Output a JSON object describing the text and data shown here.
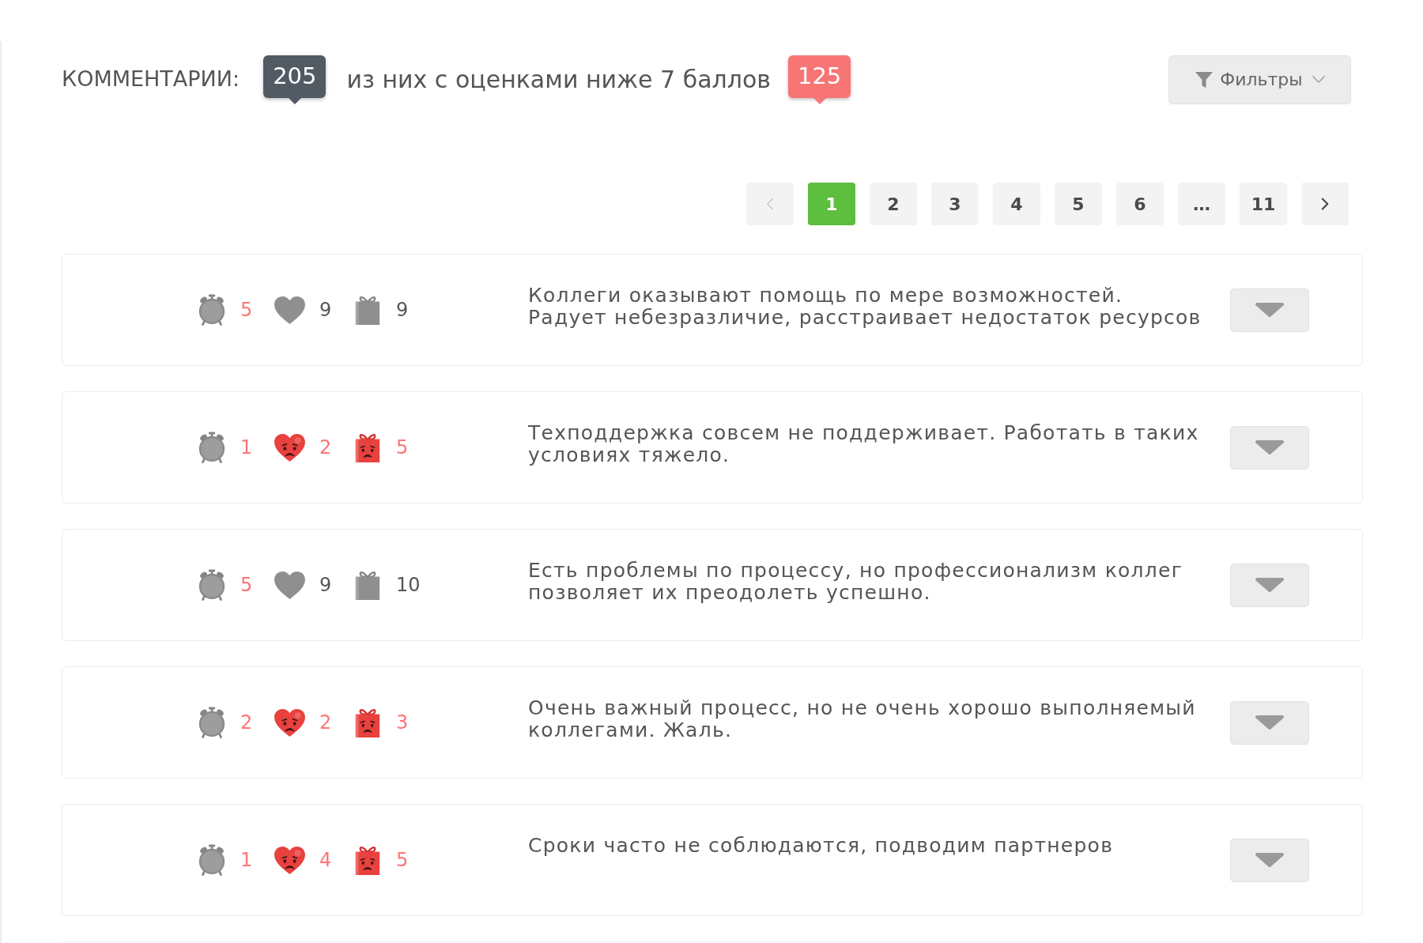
{
  "header": {
    "title": "КОММЕНТАРИИ:",
    "total": "205",
    "caption": "из них с оценками ниже 7 баллов",
    "low_count": "125",
    "filter_button": "Фильтры"
  },
  "pagination": [
    {
      "kind": "prev",
      "disabled": true
    },
    {
      "kind": "page",
      "label": "1",
      "selected": true
    },
    {
      "kind": "page",
      "label": "2",
      "selected": false
    },
    {
      "kind": "page",
      "label": "3",
      "selected": false
    },
    {
      "kind": "page",
      "label": "4",
      "selected": false
    },
    {
      "kind": "page",
      "label": "5",
      "selected": false
    },
    {
      "kind": "page",
      "label": "6",
      "selected": false
    },
    {
      "kind": "gap",
      "label": "…"
    },
    {
      "kind": "page",
      "label": "11",
      "selected": false
    },
    {
      "kind": "next",
      "disabled": false
    }
  ],
  "comments": [
    {
      "metrics": [
        {
          "kind": "clock",
          "value": "5",
          "low": true
        },
        {
          "kind": "heart",
          "value": "9",
          "low": false
        },
        {
          "kind": "gift",
          "value": "9",
          "low": false
        }
      ],
      "text": "Коллеги оказывают помощь по мере возможностей.\nРадует небезразличие, расстраивает недостаток ресурсов"
    },
    {
      "metrics": [
        {
          "kind": "clock",
          "value": "1",
          "low": true
        },
        {
          "kind": "heart",
          "value": "2",
          "low": true
        },
        {
          "kind": "gift",
          "value": "5",
          "low": true
        }
      ],
      "text": "Техподдержка совсем не поддерживает. Работать в таких условиях тяжело."
    },
    {
      "metrics": [
        {
          "kind": "clock",
          "value": "5",
          "low": true
        },
        {
          "kind": "heart",
          "value": "9",
          "low": false
        },
        {
          "kind": "gift",
          "value": "10",
          "low": false
        }
      ],
      "text": "Есть проблемы по процессу, но профессионализм коллег позволяет их преодолеть успешно."
    },
    {
      "metrics": [
        {
          "kind": "clock",
          "value": "2",
          "low": true
        },
        {
          "kind": "heart",
          "value": "2",
          "low": true
        },
        {
          "kind": "gift",
          "value": "3",
          "low": true
        }
      ],
      "text": "Очень важный процесс, но не очень хорошо выполняемый коллегами. Жаль."
    },
    {
      "metrics": [
        {
          "kind": "clock",
          "value": "1",
          "low": true
        },
        {
          "kind": "heart",
          "value": "4",
          "low": true
        },
        {
          "kind": "gift",
          "value": "5",
          "low": true
        }
      ],
      "text": "Сроки часто не соблюдаются, подводим партнеров"
    }
  ]
}
